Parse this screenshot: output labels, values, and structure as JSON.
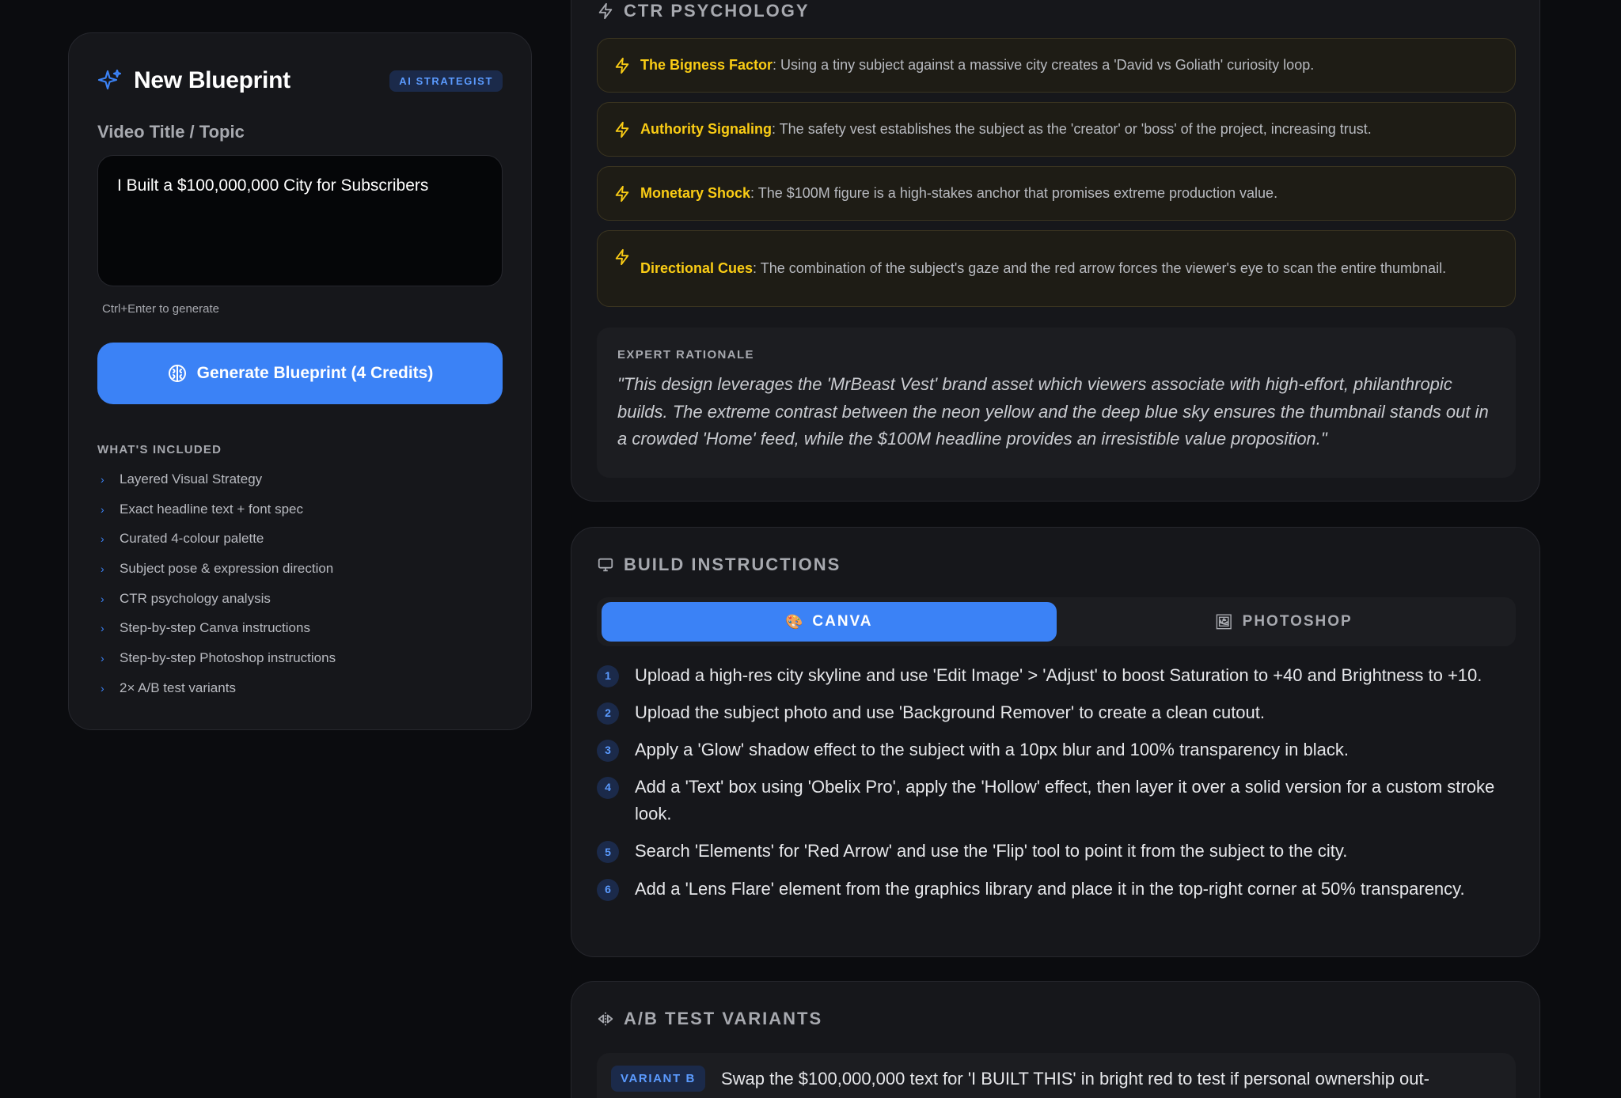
{
  "left_panel": {
    "title": "New Blueprint",
    "badge": "AI STRATEGIST",
    "field_label": "Video Title / Topic",
    "topic_value": "I Built a $100,000,000 City for Subscribers",
    "hint": "Ctrl+Enter to generate",
    "generate_button": "Generate Blueprint (4 Credits)",
    "included_title": "WHAT'S INCLUDED",
    "included_items": [
      "Layered Visual Strategy",
      "Exact headline text + font spec",
      "Curated 4-colour palette",
      "Subject pose & expression direction",
      "CTR psychology analysis",
      "Step-by-step Canva instructions",
      "Step-by-step Photoshop instructions",
      "2× A/B test variants"
    ]
  },
  "ctr": {
    "title": "CTR PSYCHOLOGY",
    "insights": [
      {
        "name": "The Bigness Factor",
        "text": ": Using a tiny subject against a massive city creates a 'David vs Goliath' curiosity loop."
      },
      {
        "name": "Authority Signaling",
        "text": ": The safety vest establishes the subject as the 'creator' or 'boss' of the project, increasing trust."
      },
      {
        "name": "Monetary Shock",
        "text": ": The $100M figure is a high-stakes anchor that promises extreme production value."
      },
      {
        "name": "Directional Cues",
        "text": ": The combination of the subject's gaze and the red arrow forces the viewer's eye to scan the entire thumbnail."
      }
    ],
    "rationale_label": "EXPERT RATIONALE",
    "rationale_text": "\"This design leverages the 'MrBeast Vest' brand asset which viewers associate with high-effort, philanthropic builds. The extreme contrast between the neon yellow and the deep blue sky ensures the thumbnail stands out in a crowded 'Home' feed, while the $100M headline provides an irresistible value proposition.\""
  },
  "build": {
    "title": "BUILD INSTRUCTIONS",
    "tabs": [
      {
        "label": "CANVA",
        "icon": "🎨",
        "active": true
      },
      {
        "label": "PHOTOSHOP",
        "icon": "🖼",
        "active": false
      }
    ],
    "steps": [
      {
        "num": "1",
        "text": "Upload a high-res city skyline and use 'Edit Image' > 'Adjust' to boost Saturation to +40 and Brightness to +10."
      },
      {
        "num": "2",
        "text": "Upload the subject photo and use 'Background Remover' to create a clean cutout."
      },
      {
        "num": "3",
        "text": "Apply a 'Glow' shadow effect to the subject with a 10px blur and 100% transparency in black."
      },
      {
        "num": "4",
        "text": "Add a 'Text' box using 'Obelix Pro', apply the 'Hollow' effect, then layer it over a solid version for a custom stroke look."
      },
      {
        "num": "5",
        "text": "Search 'Elements' for 'Red Arrow' and use the 'Flip' tool to point it from the subject to the city."
      },
      {
        "num": "6",
        "text": "Add a 'Lens Flare' element from the graphics library and place it in the top-right corner at 50% transparency."
      }
    ]
  },
  "ab": {
    "title": "A/B TEST VARIANTS",
    "variant_badge": "VARIANT B",
    "variant_text": "Swap the $100,000,000 text for 'I BUILT THIS' in bright red to test if personal ownership out-"
  },
  "colors": {
    "accent": "#3b82f6",
    "highlight": "#facc15",
    "background": "#0b0c0f",
    "card": "#16171b"
  }
}
